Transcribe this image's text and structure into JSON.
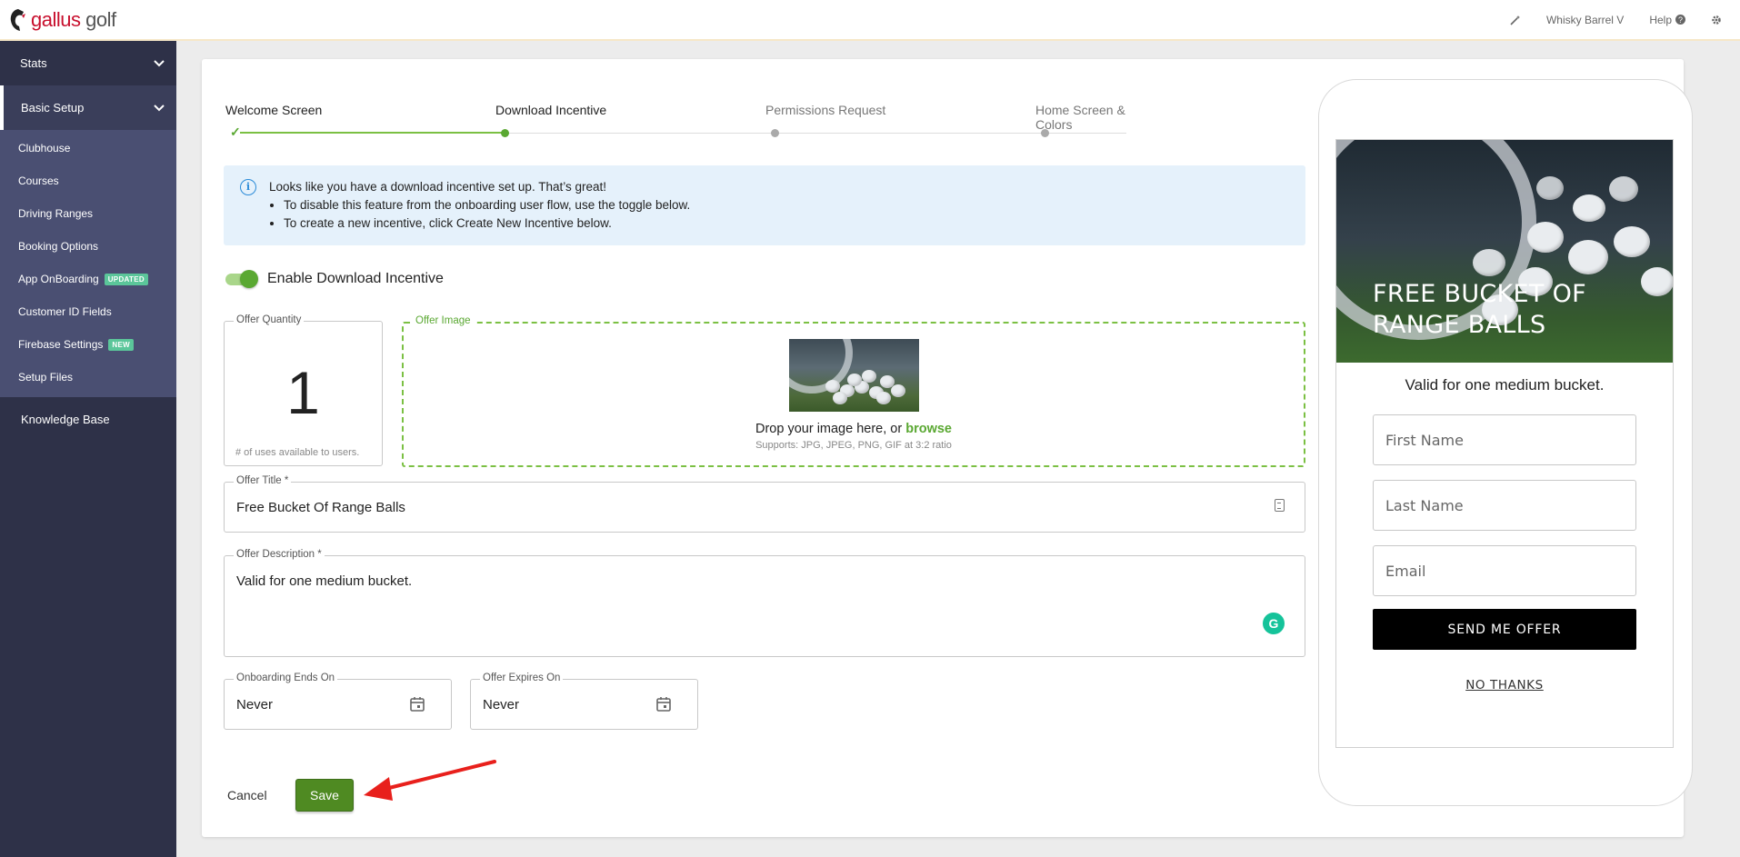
{
  "brand": {
    "name_part1": "gallus",
    "name_part2": " golf"
  },
  "topbar": {
    "user": "Whisky Barrel V",
    "help": "Help"
  },
  "sidebar": {
    "stats": "Stats",
    "basic_setup": "Basic Setup",
    "items": [
      {
        "label": "Clubhouse"
      },
      {
        "label": "Courses"
      },
      {
        "label": "Driving Ranges"
      },
      {
        "label": "Booking Options"
      },
      {
        "label": "App OnBoarding",
        "badge": "UPDATED"
      },
      {
        "label": "Customer ID Fields"
      },
      {
        "label": "Firebase Settings",
        "badge": "NEW"
      },
      {
        "label": "Setup Files"
      }
    ],
    "knowledge_base": "Knowledge Base"
  },
  "stepper": {
    "steps": [
      "Welcome Screen",
      "Download Incentive",
      "Permissions Request",
      "Home Screen & Colors"
    ]
  },
  "info": {
    "title": "Looks like you have a download incentive set up. That’s great!",
    "bullets": [
      "To disable this feature from the onboarding user flow, use the toggle below.",
      "To create a new incentive, click Create New Incentive below."
    ]
  },
  "toggle": {
    "label": "Enable Download Incentive",
    "on": true
  },
  "quantity": {
    "legend": "Offer Quantity",
    "value": "1",
    "help": "# of uses available to users."
  },
  "image": {
    "legend": "Offer Image",
    "drop_text": "Drop your image here, or ",
    "browse": "browse",
    "supports": "Supports: JPG, JPEG, PNG, GIF at 3:2 ratio"
  },
  "title_field": {
    "legend": "Offer Title *",
    "value": "Free Bucket Of Range Balls"
  },
  "desc_field": {
    "legend": "Offer Description *",
    "value": "Valid for one medium bucket."
  },
  "onboarding_ends": {
    "legend": "Onboarding Ends On",
    "value": "Never"
  },
  "offer_expires": {
    "legend": "Offer Expires On",
    "value": "Never"
  },
  "actions": {
    "cancel": "Cancel",
    "save": "Save"
  },
  "preview": {
    "hero_title": "FREE BUCKET OF RANGE BALLS",
    "desc": "Valid for one medium bucket.",
    "first_name": "First Name",
    "last_name": "Last Name",
    "email": "Email",
    "send": "SEND ME OFFER",
    "no_thanks": "NO THANKS"
  },
  "colors": {
    "accent_green": "#5aa832",
    "sidebar": "#2e3148",
    "submenu": "#4a4f72",
    "annotation_red": "#e8201c"
  }
}
